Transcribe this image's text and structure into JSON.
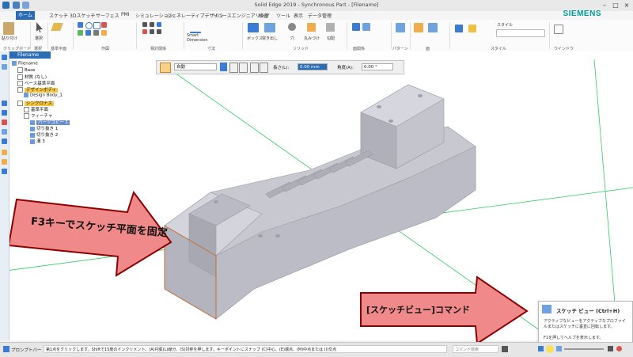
{
  "window": {
    "title": "Solid Edge 2019 - Synchronous Part - [Filename]"
  },
  "tabs": [
    "ホーム",
    "スケッチ",
    "3Dスケッチ",
    "サーフェス",
    "PMI",
    "シミュレーション",
    "ジェネレーティブデザイン",
    "リバースエンジニアリング",
    "検査",
    "ツール",
    "表示",
    "データ管理"
  ],
  "brand": "SIEMENS",
  "ribbon": {
    "paste": "貼り付け",
    "select": "選択",
    "smart_dimension": [
      "Smart",
      "Dimension"
    ],
    "box": "ボックス",
    "extrude": "突き出し",
    "hole": "穴",
    "round": "丸みづけ",
    "draft": "勾配",
    "style": "スタイル",
    "groups": [
      "クリップボード",
      "選択",
      "基準平面",
      "作図",
      "相対関係",
      "寸法",
      "ソリッド",
      "面関係",
      "パターン",
      "面",
      "スタイル",
      "ウインドウ"
    ]
  },
  "pathfinder": {
    "tab": "Filename",
    "tree": [
      {
        "label": "Filename",
        "kind": "file"
      },
      {
        "label": "Base",
        "kind": "item"
      },
      {
        "label": "材質 (なし)",
        "kind": "item"
      },
      {
        "label": "ベース基準平面",
        "kind": "item"
      },
      {
        "label": "デザインボディ",
        "kind": "selected"
      },
      {
        "label": "Design Body_1",
        "kind": "item"
      },
      {
        "label": "シンクロナス",
        "kind": "selected"
      },
      {
        "label": "基準平面",
        "kind": "item"
      },
      {
        "label": "フィーチャ",
        "kind": "item"
      },
      {
        "label": "パーツコピー 1",
        "kind": "highlight"
      },
      {
        "label": "切り抜き 1",
        "kind": "item"
      },
      {
        "label": "切り抜き 2",
        "kind": "item"
      },
      {
        "label": "溝 3",
        "kind": "item"
      }
    ]
  },
  "commandbar": {
    "mode": "自動",
    "length_label": "長さ(L):",
    "length_value": "0.00 mm",
    "angle_label": "角度(A):",
    "angle_value": "0.00 °"
  },
  "callouts": {
    "f3": "F3キーでスケッチ平面を固定",
    "sketch_view": "[スケッチビュー]コマンド"
  },
  "tooltip": {
    "title": "スケッチ ビュー (Ctrl+H)",
    "body": "アクティブなビューをアクティブなプロファイルまたはスケッチに垂直に回転します。",
    "help": "F1を押してヘルプを表示します。"
  },
  "statusbar": {
    "prompt_label": "プロンプトバー",
    "message": "第1点をクリックします。Shiftで15度のインクリメント。(A)円弧(L)線分、(S)対称を押します。キーポイントにスナップ (C)中心、(E)端点、(M)中点または (I)交点",
    "search_placeholder": "コマンド検索"
  },
  "colors": {
    "accent": "#2a6db5",
    "arrow": "#f08a8a",
    "arrow_outline": "#8b0000",
    "model": "#c4c4cc"
  }
}
